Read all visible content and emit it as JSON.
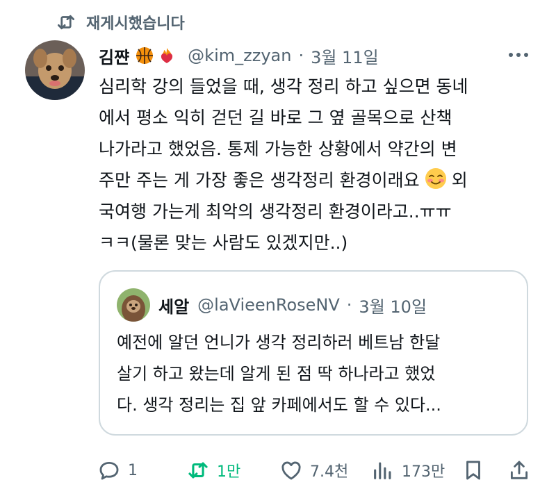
{
  "retweet": {
    "label": "재게시했습니다",
    "icon": "repost-icon"
  },
  "tweet": {
    "author_name": "김쨘",
    "handle": "@kim_zzyan",
    "dot": "·",
    "date": "3월 11일",
    "name_emojis": [
      "basketball-icon",
      "fire-heart-icon"
    ],
    "text_lines": [
      "심리학 강의 들었을 때, 생각 정리 하고 싶으면 동네",
      "에서 평소 익히 걷던 길 바로 그 옆 골목으로 산책",
      "나가라고 했었음. 통제 가능한 상황에서 약간의 변",
      "주만 주는 게 가장 좋은 생각정리 환경이래요",
      "외",
      "국여행 가는게 최악의 생각정리 환경이라고..ㅠㅠ",
      "ㅋㅋ(물론 맞는 사람도 있겠지만..)"
    ]
  },
  "quote": {
    "author_name": "세알",
    "handle": "@laVieenRoseNV",
    "dot": "·",
    "date": "3월 10일",
    "text_lines": [
      "예전에 알던 언니가 생각 정리하러 베트남 한달",
      "살기 하고 왔는데 알게 된 점 딱 하나라고 했었",
      "다. 생각 정리는 집 앞 카페에서도 할 수 있다..."
    ]
  },
  "actions": {
    "reply_count": "1",
    "repost_count": "1만",
    "like_count": "7.4천",
    "view_count": "173만"
  },
  "colors": {
    "muted": "#536471",
    "repost_green": "#00ba7c",
    "text": "#0f1419",
    "border": "#cfd9de"
  }
}
